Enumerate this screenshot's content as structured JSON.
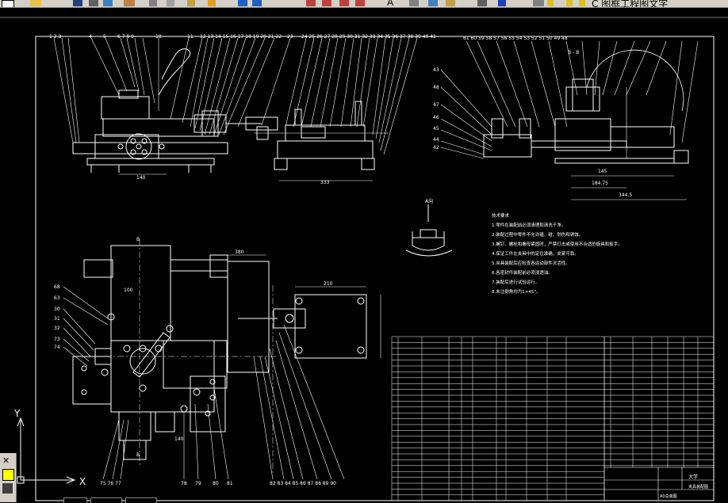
{
  "toolbar": {
    "text_label": "A",
    "layer_text": "C 图框工程图文字"
  },
  "drawing": {
    "top_left_dims": {
      "d1": "140"
    },
    "top_mid_dims": {
      "d1": "333"
    },
    "top_right_dims": {
      "d1": "145",
      "d2": "184.75",
      "d3": "344.5",
      "section": "B - B"
    },
    "plan_dims": {
      "d1": "380",
      "d2": "210",
      "d3": "100",
      "d4": "140"
    },
    "section_marks": {
      "top": "B",
      "bottom": "B"
    },
    "detail_label": "A向",
    "notes_title": "技术要求",
    "notes": [
      "1.零件在装配前必须清理和清洗干净。",
      "2.装配过程中零件不允许磕、碰、划伤和锈蚀。",
      "3.螺钉、螺栓和螺母紧固时，严禁打击或使用不合适的旋具和扳手。",
      "4.保证工件在夹具中的定位准确，夹紧可靠。",
      "5.夹具装配后应检查各运动部件灵活性。",
      "6.各密封件装配前必须浸透油。",
      "7.装配后进行试验运行。",
      "8.未注倒角均为1×45°。",
      "9.夹具装配后涂防锈漆。"
    ],
    "title_block": {
      "name": "夹具装配图",
      "company": "大学",
      "code": "A0总装图"
    }
  },
  "ucs": {
    "x_label": "X",
    "y_label": "Y"
  }
}
